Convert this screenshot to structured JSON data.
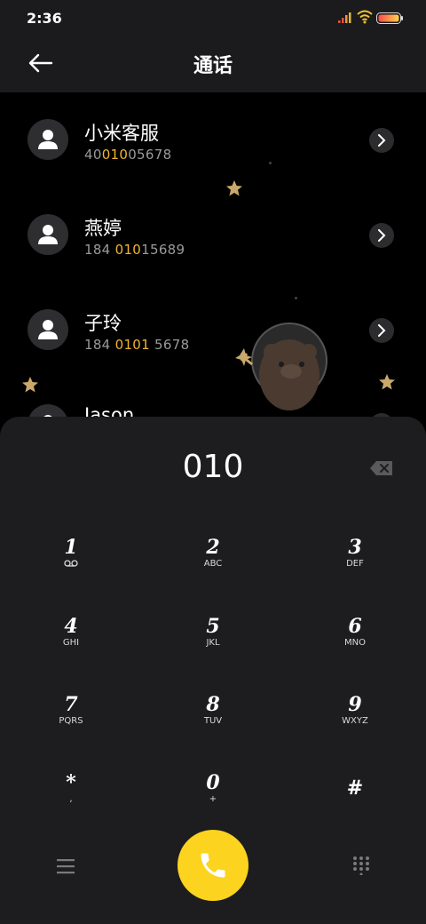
{
  "status_bar": {
    "time": "2:36"
  },
  "header": {
    "title": "通话"
  },
  "contacts": [
    {
      "name": "小米客服",
      "number_parts": [
        "40",
        "010",
        "05678"
      ]
    },
    {
      "name": "燕婷",
      "number_parts": [
        "184 ",
        "010",
        "15689"
      ]
    },
    {
      "name": "子玲",
      "number_parts": [
        "184 ",
        "0101",
        " 5678"
      ]
    },
    {
      "name": "Jason",
      "number_parts": [
        "",
        "",
        ""
      ]
    }
  ],
  "dialpad": {
    "entered": "010",
    "keys": [
      {
        "digit": "1",
        "letters": ""
      },
      {
        "digit": "2",
        "letters": "ABC"
      },
      {
        "digit": "3",
        "letters": "DEF"
      },
      {
        "digit": "4",
        "letters": "GHI"
      },
      {
        "digit": "5",
        "letters": "JKL"
      },
      {
        "digit": "6",
        "letters": "MNO"
      },
      {
        "digit": "7",
        "letters": "PQRS"
      },
      {
        "digit": "8",
        "letters": "TUV"
      },
      {
        "digit": "9",
        "letters": "WXYZ"
      },
      {
        "digit": "*",
        "letters": ","
      },
      {
        "digit": "0",
        "letters": "+"
      },
      {
        "digit": "#",
        "letters": ""
      }
    ]
  },
  "colors": {
    "accent": "#fcd31f",
    "highlight": "#f0b431",
    "sheet": "#1d1d1f"
  },
  "icons": [
    "back-arrow-icon",
    "person-icon",
    "chevron-right-icon",
    "backspace-icon",
    "voicemail-icon",
    "menu-icon",
    "phone-icon",
    "dialpad-grid-icon"
  ]
}
